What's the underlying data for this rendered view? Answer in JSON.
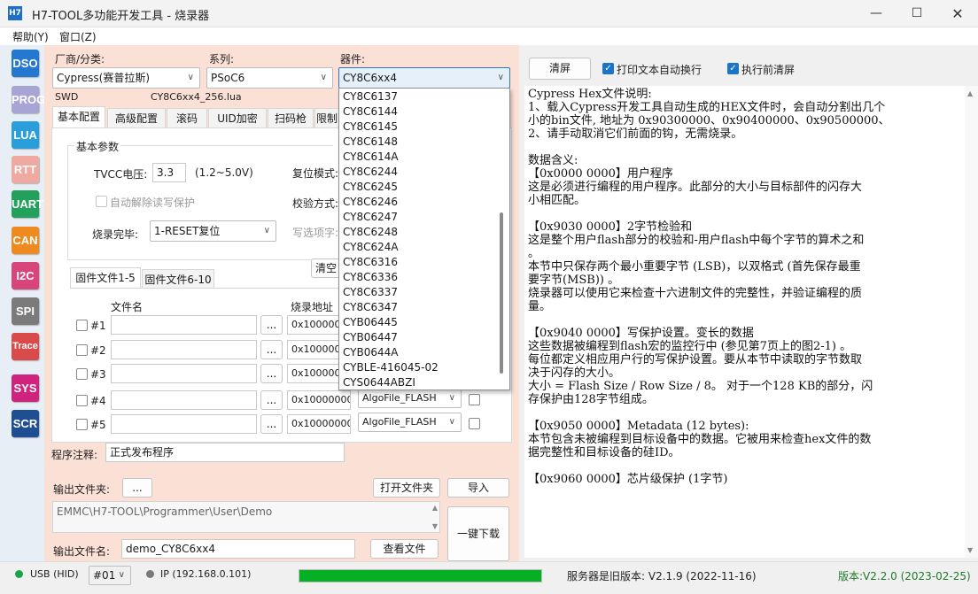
{
  "window": {
    "icon": "H7",
    "title": "H7-TOOL多功能开发工具 - 烧录器",
    "controls": [
      "minimize-icon",
      "maximize-icon",
      "close-icon"
    ]
  },
  "menu": [
    "帮助(Y)",
    "窗口(Z)"
  ],
  "nav": [
    {
      "label": "DSO",
      "color": "#2478d0"
    },
    {
      "label": "PROG",
      "color": "#a7a5d4"
    },
    {
      "label": "LUA",
      "color": "#2a9edb"
    },
    {
      "label": "RTT",
      "color": "#f0a9a0"
    },
    {
      "label": "UART",
      "color": "#23a15c"
    },
    {
      "label": "CAN",
      "color": "#ef8a1f"
    },
    {
      "label": "I2C",
      "color": "#d7457a"
    },
    {
      "label": "SPI",
      "color": "#7b7b7b"
    },
    {
      "label": "Trace",
      "color": "#d94b4b"
    },
    {
      "label": "SYS",
      "color": "#d0237e"
    },
    {
      "label": "SCR",
      "color": "#1f4e93"
    }
  ],
  "selectors": {
    "vendor": {
      "label": "厂商/分类:",
      "value": "Cypress(赛普拉斯)"
    },
    "series": {
      "label": "系列:",
      "value": "PSoC6"
    },
    "device": {
      "label": "器件:",
      "value": "CY8C6xx4"
    }
  },
  "info": {
    "interface": "SWD",
    "script": "CY8C6xx4_256.lua"
  },
  "tabs": [
    "基本配置",
    "高级配置",
    "滚码",
    "UID加密",
    "扫码枪",
    "限制"
  ],
  "basic": {
    "group": "基本参数",
    "tvcc_label": "TVCC电压:",
    "tvcc_value": "3.3",
    "tvcc_range": "(1.2~5.0V)",
    "reset_mode_label": "复位模式:",
    "auto_unlock": "自动解除读写保护",
    "verify_label": "校验方式:",
    "after_label": "烧录完毕:",
    "after_value": "1-RESET复位",
    "write_opt_label": "写选项字:"
  },
  "file_tabs": [
    "固件文件1-5",
    "固件文件6-10"
  ],
  "clear_btn": "清空",
  "file_table": {
    "col_file": "文件名",
    "col_addr": "烧录地址",
    "rows": [
      {
        "id": "#1",
        "addr": "0x1000000"
      },
      {
        "id": "#2",
        "addr": "0x1000000"
      },
      {
        "id": "#3",
        "addr": "0x1000000"
      },
      {
        "id": "#4",
        "addr": "0x10000000",
        "algo": "AlgoFile_FLASH"
      },
      {
        "id": "#5",
        "addr": "0x10000000",
        "algo": "AlgoFile_FLASH"
      }
    ],
    "browse": "..."
  },
  "program_note": {
    "label": "程序注释:",
    "value": "正式发布程序"
  },
  "output": {
    "folder_label": "输出文件夹:",
    "browse": "...",
    "open_folder": "打开文件夹",
    "import": "导入",
    "path": "EMMC\\H7-TOOL\\Programmer\\User\\Demo",
    "name_label": "输出文件名:",
    "name_value": "demo_CY8C6xx4",
    "view_file": "查看文件",
    "one_click": "一键下载"
  },
  "dropdown_items": [
    "CY8C6137",
    "CY8C6144",
    "CY8C6145",
    "CY8C6148",
    "CY8C614A",
    "CY8C6244",
    "CY8C6245",
    "CY8C6246",
    "CY8C6247",
    "CY8C6248",
    "CY8C624A",
    "CY8C6316",
    "CY8C6336",
    "CY8C6337",
    "CY8C6347",
    "CYB06445",
    "CYB06447",
    "CYB0644A",
    "CYBLE-416045-02",
    "CYS0644ABZI"
  ],
  "right": {
    "clear": "清屏",
    "wrap": "打印文本自动换行",
    "clear_before": "执行前清屏",
    "lines": [
      "Cypress Hex文件说明:",
      "1、载入Cypress开发工具自动生成的HEX文件时，会自动分割出几个",
      "小的bin文件, 地址为 0x90300000、0x90400000、0x90500000、",
      "2、请手动取消它们前面的钩，无需烧录。",
      "",
      "数据含义:",
      "【0x0000 0000】用户程序",
      "这是必须进行编程的用户程序。此部分的大小与目标部件的闪存大",
      "小相匹配。",
      "",
      "【0x9030 0000】2字节检验和",
      "这是整个用户flash部分的校验和-用户flash中每个字节的算术之和",
      "。",
      "本节中只保存两个最小重要字节 (LSB)，以双格式 (首先保存最重",
      "要字节(MSB)) 。",
      "烧录器可以使用它来检查十六进制文件的完整性，并验证编程的质",
      "量。",
      "",
      "【0x9040 0000】写保护设置。变长的数据",
      "这些数据被编程到flash宏的监控行中 (参见第7页上的图2-1) 。",
      "每位都定义相应用户行的写保护设置。要从本节中读取的字节数取",
      "决于闪存的大小。",
      "大小 = Flash Size / Row Size / 8。 对于一个128 KB的部分，闪",
      "存保护由128字节组成。",
      "",
      "【0x9050 0000】Metadata (12 bytes):",
      "本节包含未被编程到目标设备中的数据。它被用来检查hex文件的数",
      "据完整性和目标设备的硅ID。",
      "",
      "【0x9060 0000】芯片级保护 (1字节)"
    ]
  },
  "status": {
    "usb": "USB (HID)",
    "port": "#01",
    "ip": "IP (192.168.0.101)",
    "progress": 1.0,
    "server": "服务器是旧版本: V2.1.9 (2022-11-16)",
    "version": "版本:V2.2.0 (2023-02-25)"
  }
}
